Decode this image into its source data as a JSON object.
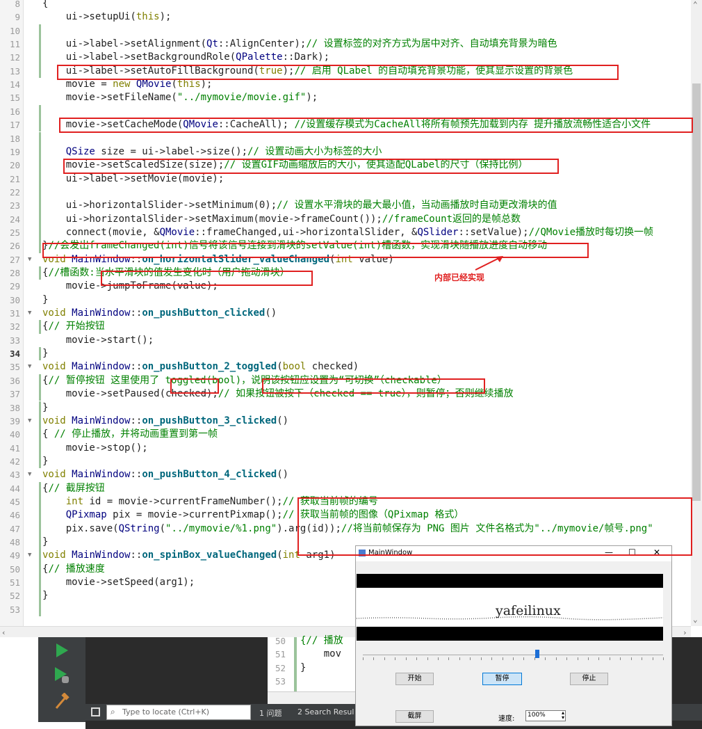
{
  "editor": {
    "lines": [
      {
        "n": "8",
        "text": "{"
      },
      {
        "n": "9",
        "text": "    ui->setupUi(this);"
      },
      {
        "n": "10",
        "text": ""
      },
      {
        "n": "11",
        "text": "    ui->label->setAlignment(Qt::AlignCenter);// 设置标签的对齐方式为居中对齐、自动填充背景为暗色"
      },
      {
        "n": "12",
        "text": "    ui->label->setBackgroundRole(QPalette::Dark);"
      },
      {
        "n": "13",
        "text": "    ui->label->setAutoFillBackground(true);// 启用 QLabel 的自动填充背景功能，使其显示设置的背景色"
      },
      {
        "n": "14",
        "text": "    movie = new QMovie(this);"
      },
      {
        "n": "15",
        "text": "    movie->setFileName(\"../mymovie/movie.gif\");"
      },
      {
        "n": "16",
        "text": ""
      },
      {
        "n": "17",
        "text": "    movie->setCacheMode(QMovie::CacheAll); //设置缓存模式为CacheAll将所有帧预先加载到内存 提升播放流畅性适合小文件"
      },
      {
        "n": "18",
        "text": ""
      },
      {
        "n": "19",
        "text": "    QSize size = ui->label->size();// 设置动画大小为标签的大小"
      },
      {
        "n": "20",
        "text": "    movie->setScaledSize(size);// 设置GIF动画缩放后的大小，使其适配QLabel的尺寸（保持比例）"
      },
      {
        "n": "21",
        "text": "    ui->label->setMovie(movie);"
      },
      {
        "n": "22",
        "text": ""
      },
      {
        "n": "23",
        "text": "    ui->horizontalSlider->setMinimum(0);// 设置水平滑块的最大最小值，当动画播放时自动更改滑块的值"
      },
      {
        "n": "24",
        "text": "    ui->horizontalSlider->setMaximum(movie->frameCount());//frameCount返回的是帧总数"
      },
      {
        "n": "25",
        "text": "    connect(movie, &QMovie::frameChanged,ui->horizontalSlider, &QSlider::setValue);//QMovie播放时每切换一帧"
      },
      {
        "n": "26",
        "text": "}//会发出frameChanged(int)信号将该信号连接到滑块的setValue(int)槽函数，实现滑块随播放进度自动移动"
      },
      {
        "n": "27",
        "text": "void MainWindow::on_horizontalSlider_valueChanged(int value)"
      },
      {
        "n": "28",
        "text": "{//槽函数:当水平滑块的值发生变化时（用户拖动滑块）"
      },
      {
        "n": "29",
        "text": "    movie->jumpToFrame(value);"
      },
      {
        "n": "30",
        "text": "}"
      },
      {
        "n": "31",
        "text": "void MainWindow::on_pushButton_clicked()"
      },
      {
        "n": "32",
        "text": "{// 开始按钮"
      },
      {
        "n": "33",
        "text": "    movie->start();"
      },
      {
        "n": "34",
        "text": "}"
      },
      {
        "n": "35",
        "text": "void MainWindow::on_pushButton_2_toggled(bool checked)"
      },
      {
        "n": "36",
        "text": "{// 暂停按钮 这里使用了 toggled(bool)，说明该按钮应设置为“可切换”（checkable）"
      },
      {
        "n": "37",
        "text": "    movie->setPaused(checked);// 如果按钮被按下（checked == true），则暂停；否则继续播放"
      },
      {
        "n": "38",
        "text": "}"
      },
      {
        "n": "39",
        "text": "void MainWindow::on_pushButton_3_clicked()"
      },
      {
        "n": "40",
        "text": "{ // 停止播放，并将动画重置到第一帧"
      },
      {
        "n": "41",
        "text": "    movie->stop();"
      },
      {
        "n": "42",
        "text": "}"
      },
      {
        "n": "43",
        "text": "void MainWindow::on_pushButton_4_clicked()"
      },
      {
        "n": "44",
        "text": "{// 截屏按钮"
      },
      {
        "n": "45",
        "text": "    int id = movie->currentFrameNumber();// 获取当前帧的编号"
      },
      {
        "n": "46",
        "text": "    QPixmap pix = movie->currentPixmap();// 获取当前帧的图像（QPixmap 格式）"
      },
      {
        "n": "47",
        "text": "    pix.save(QString(\"../mymovie/%1.png\").arg(id));//将当前帧保存为 PNG 图片 文件名格式为\"../mymovie/帧号.png\""
      },
      {
        "n": "48",
        "text": "}"
      },
      {
        "n": "49",
        "text": "void MainWindow::on_spinBox_valueChanged(int arg1)"
      },
      {
        "n": "50",
        "text": "{// 播放速度"
      },
      {
        "n": "51",
        "text": "    movie->setSpeed(arg1);"
      },
      {
        "n": "52",
        "text": "}"
      },
      {
        "n": "53",
        "text": ""
      }
    ],
    "annotation": "内部已经实现"
  },
  "mini_editor": {
    "lines": [
      {
        "n": "50",
        "text": "{// 播放"
      },
      {
        "n": "51",
        "text": "    mov"
      },
      {
        "n": "52",
        "text": "}"
      },
      {
        "n": "53",
        "text": ""
      }
    ]
  },
  "bottom_bar": {
    "locate_placeholder": "Type to locate (Ctrl+K)",
    "issues_tab": "1 问题",
    "search_tab": "2 Search Resul"
  },
  "window": {
    "title": "MainWindow",
    "minimize": "—",
    "maximize": "☐",
    "close": "✕",
    "gif_text": "yafeilinux",
    "slider_fraction": 0.58,
    "start_label": "开始",
    "pause_label": "暂停",
    "stop_label": "停止",
    "screenshot_label": "截屏",
    "speed_label": "速度:",
    "speed_value": "100%"
  },
  "colors": {
    "keyword": "#808000",
    "type": "#00007f",
    "string": "#008000",
    "comment": "#008000",
    "func": "#00677c",
    "highlight_box": "#e02020"
  }
}
